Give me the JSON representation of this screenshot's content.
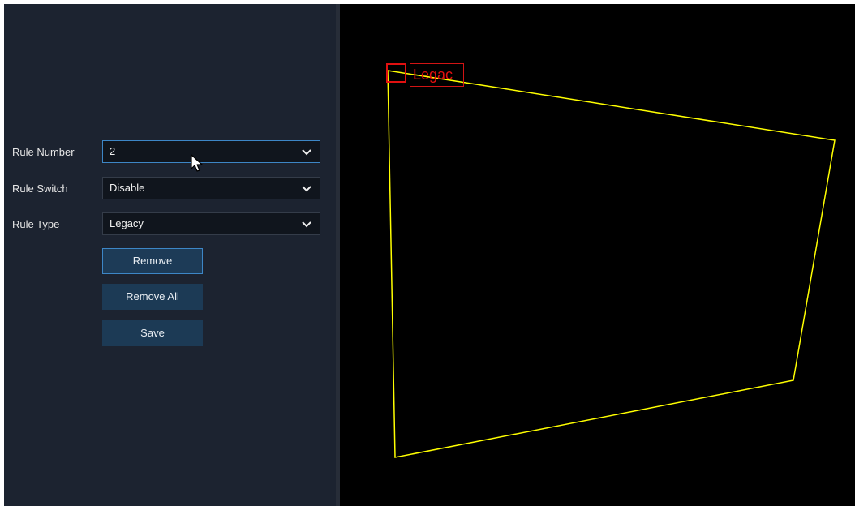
{
  "form": {
    "rule_number": {
      "label": "Rule Number",
      "value": "2"
    },
    "rule_switch": {
      "label": "Rule Switch",
      "value": "Disable"
    },
    "rule_type": {
      "label": "Rule Type",
      "value": "Legacy"
    }
  },
  "buttons": {
    "remove": "Remove",
    "remove_all": "Remove All",
    "save": "Save"
  },
  "overlay": {
    "region_label": "Legac",
    "line_color": "#ffff00",
    "label_color": "#e01010"
  },
  "icons": {
    "dropdown": "chevron-down-icon",
    "cursor": "mouse-pointer-icon"
  }
}
